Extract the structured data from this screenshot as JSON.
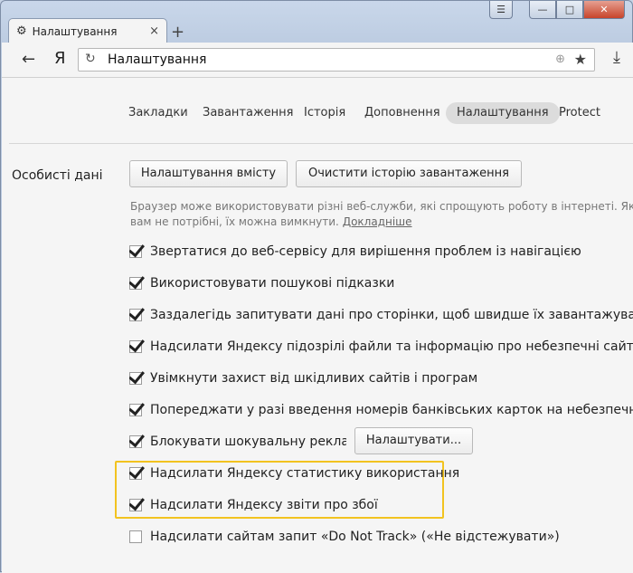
{
  "window": {
    "controls": {
      "menu": "☰",
      "minimize": "—",
      "maximize": "□",
      "close": "✕"
    }
  },
  "tab": {
    "title": "Налаштування",
    "close": "×",
    "new_tab": "+"
  },
  "toolbar": {
    "back": "←",
    "yandex_logo": "Я",
    "address": "Налаштування",
    "reload": "↻",
    "globe": "⊕",
    "star": "★",
    "download": "⤓"
  },
  "nav": {
    "items": [
      "Закладки",
      "Завантаження",
      "Історія",
      "Доповнення",
      "Налаштування",
      "Protect"
    ],
    "active": "Налаштування"
  },
  "personal": {
    "section_title": "Особисті дані",
    "content_settings_button": "Налаштування вмісту",
    "clear_history_button": "Очистити історію завантаження",
    "description_line1": "Браузер може використовувати різні веб-служби, які спрощують роботу в інтернеті. Якщо",
    "description_line2": "вам не потрібні, їх можна вимкнути.",
    "more_link": "Докладніше",
    "options": [
      {
        "label": "Звертатися до веб-сервісу для вирішення проблем із навігацією",
        "checked": true
      },
      {
        "label": "Використовувати пошукові підказки",
        "checked": true
      },
      {
        "label": "Заздалегідь запитувати дані про сторінки, щоб швидше їх завантажувати",
        "checked": true
      },
      {
        "label": "Надсилати Яндексу підозрілі файли та інформацію про небезпечні сайти",
        "checked": true
      },
      {
        "label": "Увімкнути захист від шкідливих сайтів і програм",
        "checked": true
      },
      {
        "label": "Попереджати у разі введення номерів банківських карток на небезпечних сайтах",
        "checked": true
      },
      {
        "label": "Блокувати шокувальну рекламу",
        "checked": true
      },
      {
        "label": "Надсилати Яндексу статистику використання",
        "checked": true
      },
      {
        "label": "Надсилати Яндексу звіти про збої",
        "checked": true
      },
      {
        "label": "Надсилати сайтам запит «Do Not Track» («Не відстежувати»)",
        "checked": false
      }
    ],
    "configure_button": "Налаштувати..."
  }
}
